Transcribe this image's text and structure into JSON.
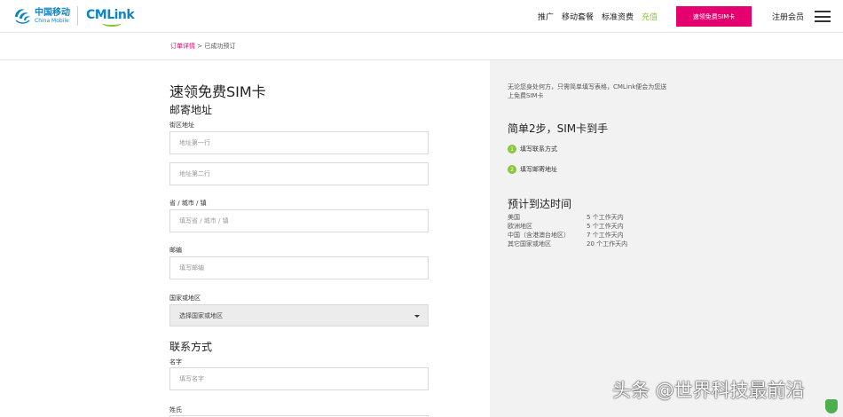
{
  "header": {
    "logo_cn": "中国移动",
    "logo_en": "China Mobile",
    "brand": "CMLink",
    "nav": [
      "推广",
      "移动套餐",
      "标准资费",
      "充值"
    ],
    "cta": "速领免费SIM卡",
    "register": "注册会员"
  },
  "breadcrumb": {
    "link": "订单详情",
    "separator": ">",
    "current": "已成功预订"
  },
  "form": {
    "title": "速领免费SIM卡",
    "mailing_heading": "邮寄地址",
    "street_label": "街区地址",
    "address1_placeholder": "地址第一行",
    "address2_placeholder": "地址第二行",
    "province_label": "省 / 城市 / 镇",
    "province_placeholder": "填写省 / 城市 / 镇",
    "postcode_label": "邮编",
    "postcode_placeholder": "填写邮编",
    "country_label": "国家或地区",
    "country_value": "选择国家或地区",
    "contact_heading": "联系方式",
    "firstname_label": "名字",
    "firstname_placeholder": "填写名字",
    "lastname_label": "姓氏"
  },
  "panel": {
    "intro": "无论您身处何方，只需简单填写表格，CMLink便会为您送上免费SIM卡",
    "steps_heading": "简单2步，SIM卡到手",
    "steps": [
      {
        "num": "1",
        "label": "填写联系方式"
      },
      {
        "num": "2",
        "label": "填写邮寄地址"
      }
    ],
    "delivery_heading": "预计到达时间",
    "delivery": [
      {
        "region": "美国",
        "time": "5 个工作天内"
      },
      {
        "region": "欧洲地区",
        "time": "5 个工作天内"
      },
      {
        "region": "中国（含港澳台地区）",
        "time": "7 个工作天内"
      },
      {
        "region": "其它国家或地区",
        "time": "20 个工作天内"
      }
    ]
  },
  "watermark": "头条 @世界科技最前沿",
  "colors": {
    "accent": "#e5006f",
    "green": "#8cc63f",
    "brand_blue": "#0a86c9",
    "panel_bg": "#f2f2f2"
  }
}
